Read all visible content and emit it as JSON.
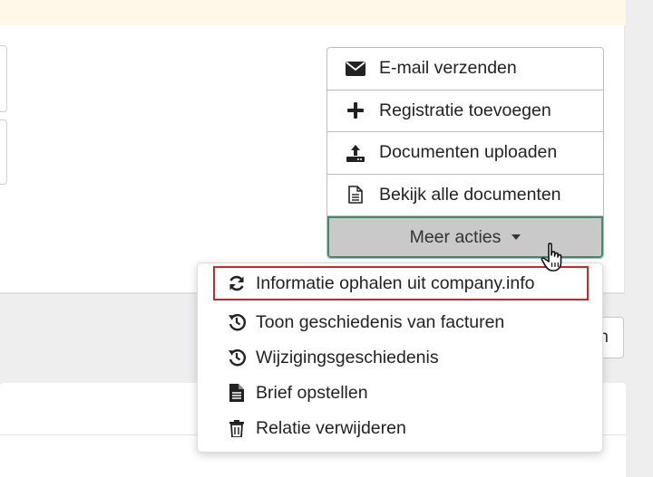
{
  "actions": {
    "items": [
      {
        "label": "E-mail verzenden",
        "icon": "envelope-icon"
      },
      {
        "label": "Registratie toevoegen",
        "icon": "plus-icon"
      },
      {
        "label": "Documenten uploaden",
        "icon": "upload-icon"
      },
      {
        "label": "Bekijk alle documenten",
        "icon": "document-icon"
      }
    ],
    "more_label": "Meer acties"
  },
  "dropdown": {
    "items": [
      {
        "label": "Informatie ophalen uit company.info",
        "icon": "sync-icon"
      },
      {
        "label": "Toon geschiedenis van facturen",
        "icon": "history-icon"
      },
      {
        "label": "Wijzigingsgeschiedenis",
        "icon": "history-icon"
      },
      {
        "label": "Brief opstellen",
        "icon": "file-icon"
      },
      {
        "label": "Relatie verwijderen",
        "icon": "trash-icon"
      }
    ],
    "highlighted_index": 0
  },
  "side_button": {
    "label": "n"
  },
  "colors": {
    "more_bg": "#c9c9c9",
    "more_border": "#3d8c6c",
    "highlight": "#d22424",
    "banner": "#fdf8e8"
  }
}
